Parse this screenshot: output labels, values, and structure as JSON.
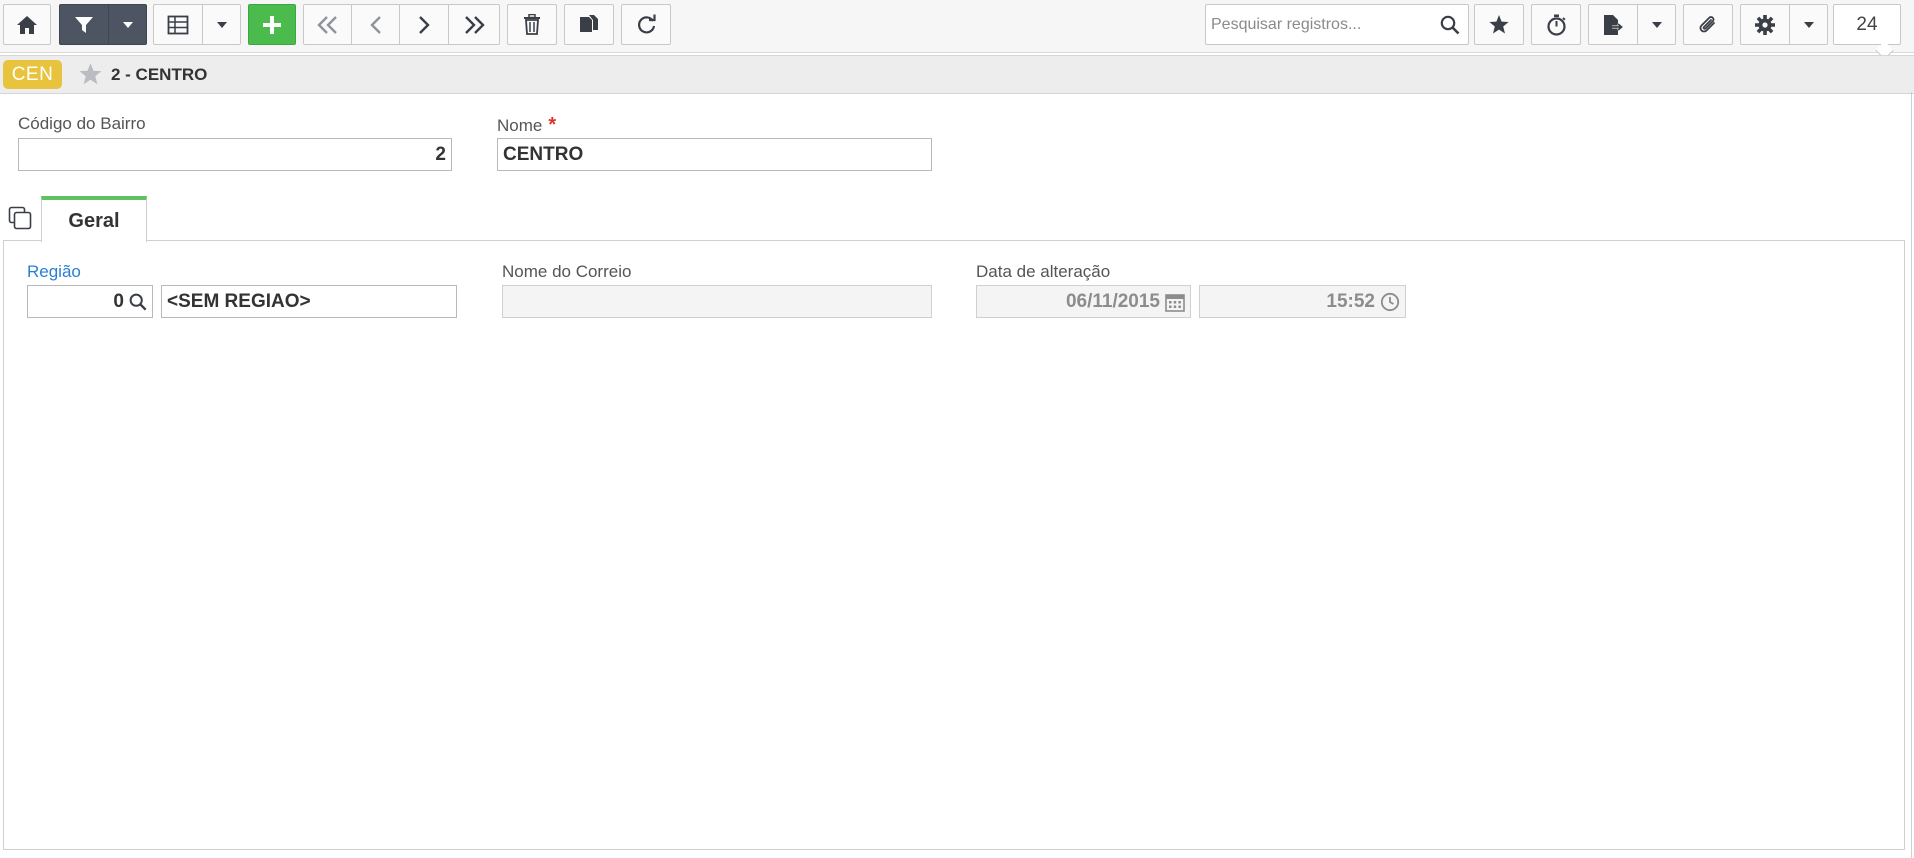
{
  "toolbar": {
    "home_icon": "home-icon",
    "filter_icon": "filter-icon",
    "grid_icon": "table-grid-icon",
    "add_icon": "plus-icon",
    "first_icon": "double-chevron-left-icon",
    "prev_icon": "chevron-left-icon",
    "next_icon": "chevron-right-icon",
    "last_icon": "double-chevron-right-icon",
    "delete_icon": "trash-icon",
    "copy_icon": "copy-icon",
    "refresh_icon": "refresh-icon",
    "search_placeholder": "Pesquisar registros...",
    "search_value": "",
    "favorite_icon": "star-icon",
    "timer_icon": "stopwatch-icon",
    "report_icon": "export-file-icon",
    "attach_icon": "paperclip-icon",
    "settings_icon": "gear-icon",
    "page_size": "24"
  },
  "header": {
    "badge": "CEN",
    "title": "2 - CENTRO"
  },
  "form": {
    "codigo_label": "Código do Bairro",
    "codigo_value": "2",
    "nome_label": "Nome",
    "nome_required": "*",
    "nome_value": "CENTRO"
  },
  "tabs": [
    {
      "label": "Geral",
      "active": true
    }
  ],
  "geral": {
    "regiao_label": "Região",
    "regiao_code": "0",
    "regiao_name": "<SEM REGIAO>",
    "correio_label": "Nome do Correio",
    "correio_value": "",
    "data_label": "Data de alteração",
    "data_value": "06/11/2015",
    "hora_value": "15:52"
  },
  "colors": {
    "accent_green": "#4cbb4e",
    "badge_yellow": "#e8c33d",
    "dark_button": "#4d5562",
    "link_blue": "#2a7fd4",
    "required_red": "#d9362b"
  }
}
